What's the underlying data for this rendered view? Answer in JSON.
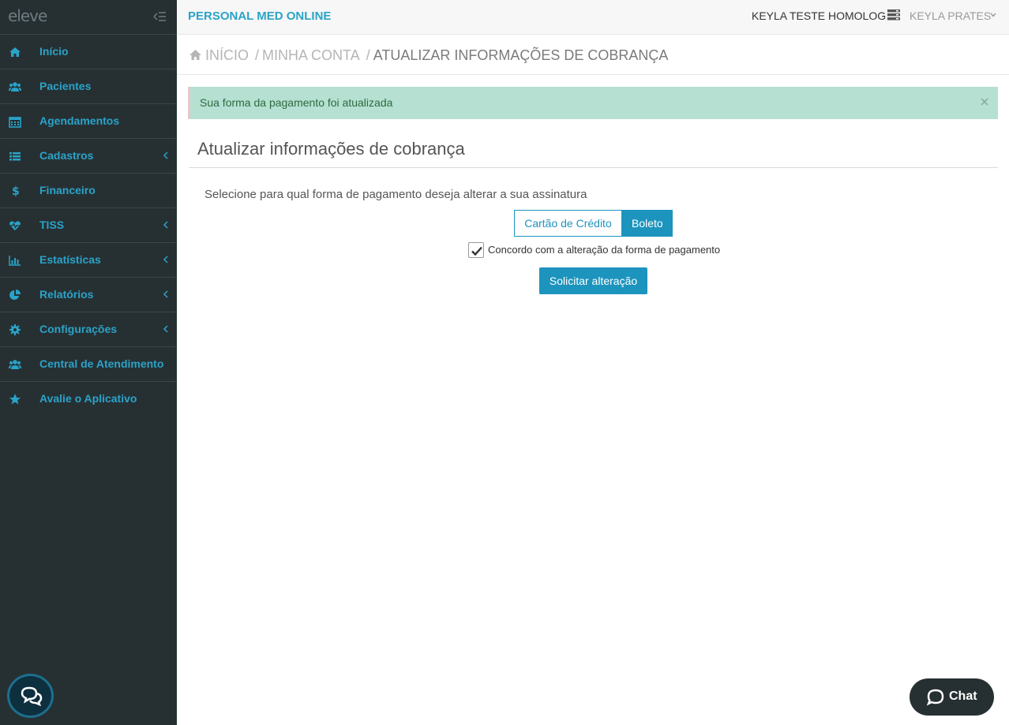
{
  "logo": {
    "text": "eleve"
  },
  "sidebar": {
    "items": [
      {
        "label": "Início",
        "icon": "home-icon",
        "has_submenu": false
      },
      {
        "label": "Pacientes",
        "icon": "users-icon",
        "has_submenu": false
      },
      {
        "label": "Agendamentos",
        "icon": "calendar-icon",
        "has_submenu": false
      },
      {
        "label": "Cadastros",
        "icon": "list-icon",
        "has_submenu": true
      },
      {
        "label": "Financeiro",
        "icon": "dollar-icon",
        "has_submenu": false
      },
      {
        "label": "TISS",
        "icon": "heartbeat-icon",
        "has_submenu": true
      },
      {
        "label": "Estatísticas",
        "icon": "bar-chart-icon",
        "has_submenu": true
      },
      {
        "label": "Relatórios",
        "icon": "pie-chart-icon",
        "has_submenu": true
      },
      {
        "label": "Configurações",
        "icon": "gear-icon",
        "has_submenu": true
      },
      {
        "label": "Central de Atendimento",
        "icon": "users-icon",
        "has_submenu": false
      },
      {
        "label": "Avalie o Aplicativo",
        "icon": "star-icon",
        "has_submenu": false
      }
    ]
  },
  "topbar": {
    "brand": "PERSONAL MED ONLINE",
    "clinic": "KEYLA TESTE HOMOLOG",
    "user": "KEYLA PRATES"
  },
  "breadcrumb": {
    "home": "INÍCIO",
    "account": "MINHA CONTA",
    "current": "ATUALIZAR INFORMAÇÕES DE COBRANÇA",
    "separator": "/"
  },
  "alert": {
    "message": "Sua forma da pagamento foi atualizada"
  },
  "page": {
    "title": "Atualizar informações de cobrança",
    "instruction": "Selecione para qual forma de pagamento deseja alterar a sua assinatura",
    "options": {
      "credit": "Cartão de Crédito",
      "boleto": "Boleto",
      "selected": "Boleto"
    },
    "agree_label": "Concordo com a alteração da forma de pagamento",
    "agree_checked": true,
    "submit_label": "Solicitar alteração"
  },
  "chat": {
    "label": "Chat"
  },
  "colors": {
    "accent": "#2aa3c8",
    "sidebar_bg": "#263033",
    "alert_bg": "#b5e0d2",
    "button": "#1c94bd"
  }
}
